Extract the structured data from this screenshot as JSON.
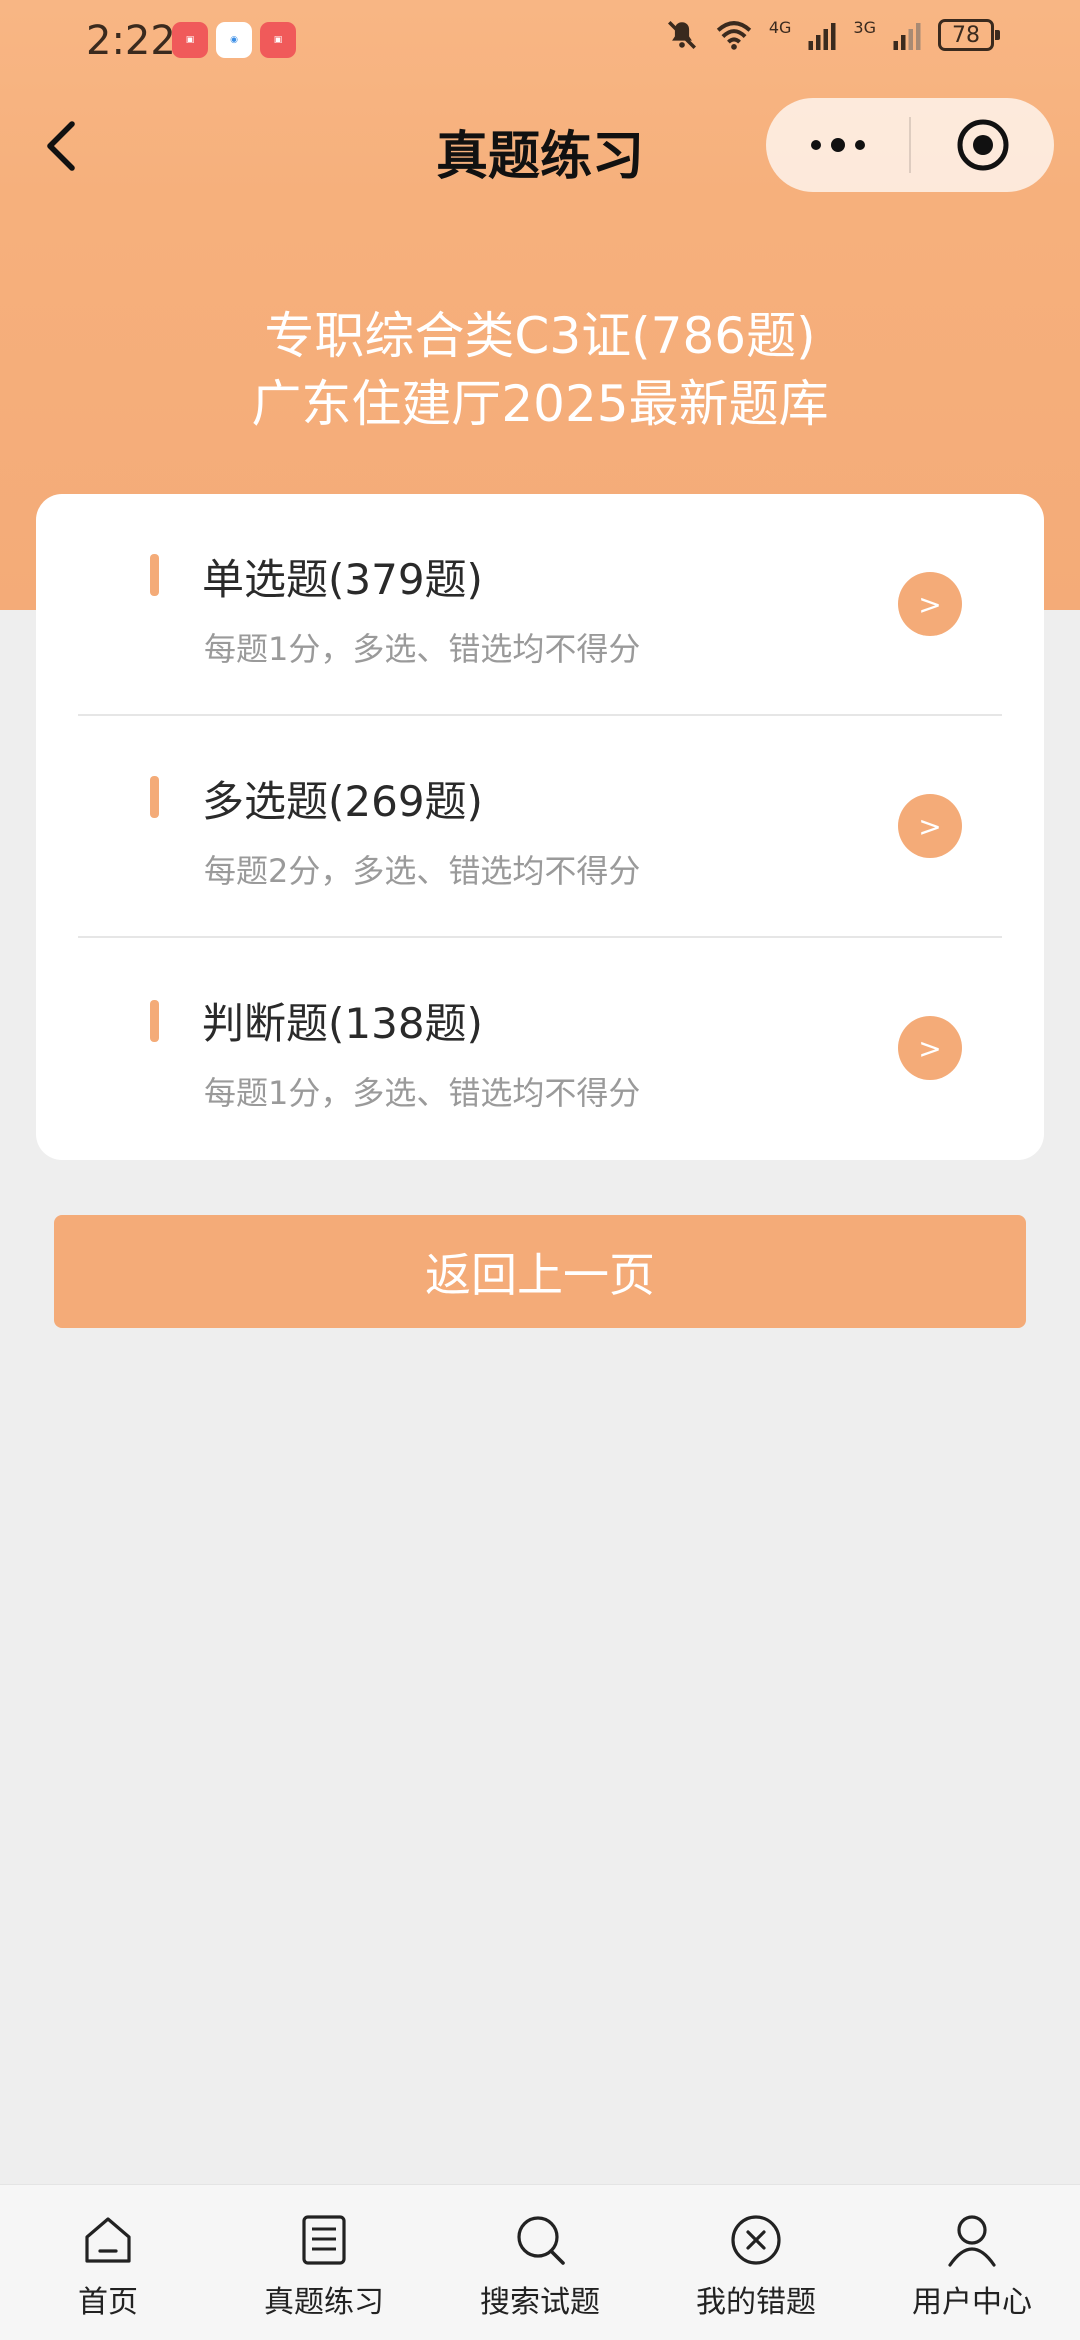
{
  "status_bar": {
    "time": "2:22",
    "network_1": "4G",
    "network_2": "3G",
    "battery": "78"
  },
  "nav": {
    "title": "真题练习"
  },
  "hero": {
    "line1": "专职综合类C3证(786题)",
    "line2": "广东住建厅2025最新题库"
  },
  "question_types": [
    {
      "title": "单选题(379题)",
      "desc": "每题1分，多选、错选均不得分",
      "arrow": ">"
    },
    {
      "title": "多选题(269题)",
      "desc": "每题2分，多选、错选均不得分",
      "arrow": ">"
    },
    {
      "title": "判断题(138题)",
      "desc": "每题1分，多选、错选均不得分",
      "arrow": ">"
    }
  ],
  "back_button": "返回上一页",
  "tabbar": [
    {
      "label": "首页",
      "icon": "home-icon"
    },
    {
      "label": "真题练习",
      "icon": "document-icon"
    },
    {
      "label": "搜索试题",
      "icon": "search-icon"
    },
    {
      "label": "我的错题",
      "icon": "close-circle-icon"
    },
    {
      "label": "用户中心",
      "icon": "user-icon"
    }
  ],
  "colors": {
    "accent": "#f4ab78",
    "header_bg": "#f8b684",
    "page_bg": "#eeeeee"
  }
}
